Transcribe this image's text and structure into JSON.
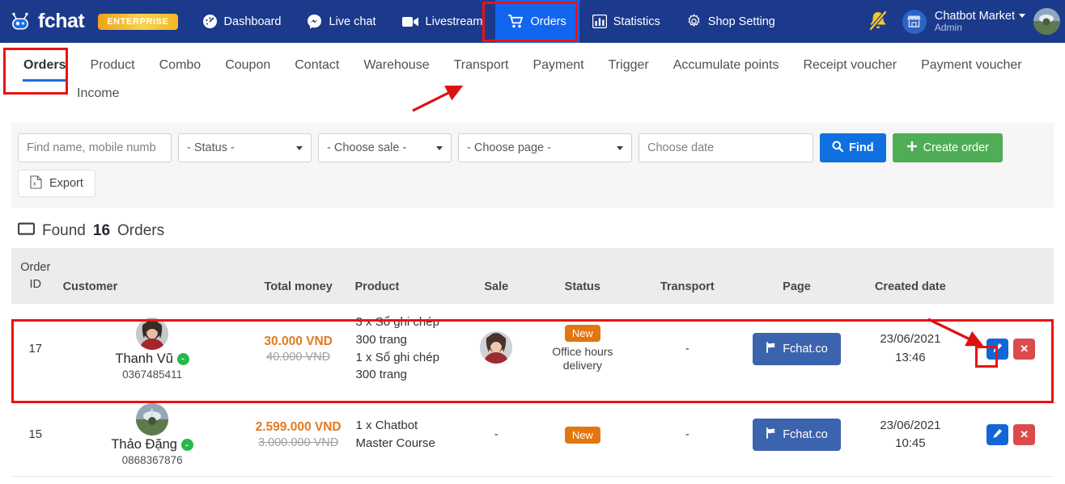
{
  "navbar": {
    "brand": "fchat",
    "badge": "ENTERPRISE",
    "items": [
      {
        "label": "Dashboard",
        "icon": "dashboard-icon",
        "active": false
      },
      {
        "label": "Live chat",
        "icon": "messenger-icon",
        "active": false
      },
      {
        "label": "Livestream",
        "icon": "video-camera-icon",
        "active": false
      },
      {
        "label": "Orders",
        "icon": "cart-icon",
        "active": true
      },
      {
        "label": "Statistics",
        "icon": "bar-chart-icon",
        "active": false
      },
      {
        "label": "Shop Setting",
        "icon": "gear-icon",
        "active": false
      }
    ],
    "account_name": "Chatbot Market",
    "account_role": "Admin"
  },
  "subnav": {
    "items": [
      {
        "label": "Orders",
        "active": true
      },
      {
        "label": "Product",
        "active": false
      },
      {
        "label": "Combo",
        "active": false
      },
      {
        "label": "Coupon",
        "active": false
      },
      {
        "label": "Contact",
        "active": false
      },
      {
        "label": "Warehouse",
        "active": false
      },
      {
        "label": "Transport",
        "active": false
      },
      {
        "label": "Payment",
        "active": false
      },
      {
        "label": "Trigger",
        "active": false
      },
      {
        "label": "Accumulate points",
        "active": false
      },
      {
        "label": "Receipt voucher",
        "active": false
      },
      {
        "label": "Payment voucher",
        "active": false
      },
      {
        "label": "Income",
        "active": false
      }
    ]
  },
  "filters": {
    "search_placeholder": "Find name, mobile numb",
    "status_select": "- Status -",
    "sale_select": "- Choose sale -",
    "page_select": "- Choose page -",
    "date_placeholder": "Choose date",
    "find_label": "Find",
    "create_label": "Create order",
    "export_label": "Export"
  },
  "results": {
    "prefix": "Found",
    "count": "16",
    "suffix": "Orders"
  },
  "table": {
    "headers": {
      "order_id_line1": "Order",
      "order_id_line2": "ID",
      "customer": "Customer",
      "total_money": "Total money",
      "product": "Product",
      "sale": "Sale",
      "status": "Status",
      "transport": "Transport",
      "page": "Page",
      "created_date": "Created date"
    },
    "rows": [
      {
        "id": "17",
        "customer_name": "Thanh Vũ",
        "customer_phone": "0367485411",
        "money_new": "30.000 VND",
        "money_old": "40.000 VND",
        "product_line1": "3 x Sổ ghi chép",
        "product_line2": "300 trang",
        "product_line3": "1 x Sổ ghi chép",
        "product_line4": "300 trang",
        "sale": "",
        "status_badge": "New",
        "status_sub_line1": "Office hours",
        "status_sub_line2": "delivery",
        "transport": "-",
        "page": "Fchat.co",
        "date_line1": "23/06/2021",
        "date_line2": "13:46",
        "highlighted": true
      },
      {
        "id": "15",
        "customer_name": "Thảo Đặng",
        "customer_phone": "0868367876",
        "money_new": "2.599.000 VND",
        "money_old": "3.000.000 VND",
        "product_line1": "1 x Chatbot",
        "product_line2": "Master Course",
        "product_line3": "",
        "product_line4": "",
        "sale": "-",
        "status_badge": "New",
        "status_sub_line1": "",
        "status_sub_line2": "",
        "transport": "-",
        "page": "Fchat.co",
        "date_line1": "23/06/2021",
        "date_line2": "10:45",
        "highlighted": false
      }
    ]
  },
  "colors": {
    "navbar_bg": "#1b3a8c",
    "nav_active": "#1266ee",
    "accent_blue": "#1070e0",
    "green": "#4fad55",
    "orange_badge": "#e2760f",
    "money_orange": "#e07a1f",
    "page_btn": "#3c63ad",
    "annotation_red": "#ee1111"
  }
}
